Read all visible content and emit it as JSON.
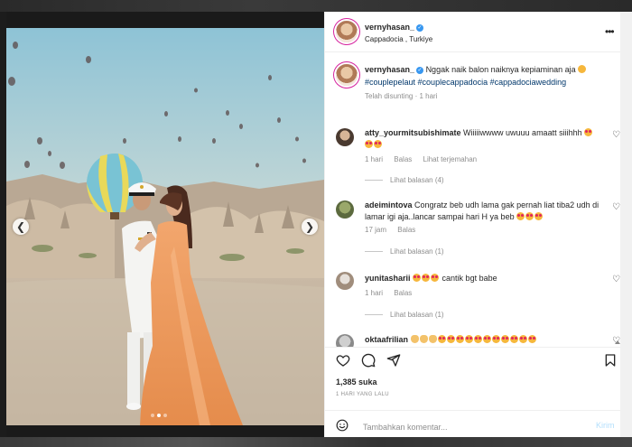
{
  "post": {
    "username": "vernyhasan_",
    "location": "Cappadocia , Turkiye",
    "more_icon": "more-horizontal-icon"
  },
  "caption": {
    "username": "vernyhasan_",
    "text": "Nggak naik balon naiknya kepiaminan aja",
    "hashtags": "#couplepelaut #couplecappadocia #cappadociawedding",
    "edited": "Telah disunting",
    "time": "1 hari"
  },
  "comments": [
    {
      "username": "atty_yourmitsubishimate",
      "text": "Wiiiiiwwww uwuuu amaatt siiihhh",
      "time": "1 hari",
      "reply": "Balas",
      "translate": "Lihat terjemahan",
      "replies": "Lihat balasan (4)"
    },
    {
      "username": "adeimintova",
      "text": "Congratz beb udh lama gak pernah liat tiba2 udh di lamar igi aja..lancar sampai hari H ya beb",
      "time": "17 jam",
      "reply": "Balas",
      "replies": "Lihat balasan (1)"
    },
    {
      "username": "yunitasharii",
      "text": "cantik bgt babe",
      "time": "1 hari",
      "reply": "Balas",
      "replies": "Lihat balasan (1)"
    },
    {
      "username": "oktaafrilian",
      "text": ""
    }
  ],
  "actions": {
    "likes": "1,385 suka",
    "time": "1 HARI YANG LALU"
  },
  "add_comment": {
    "placeholder": "Tambahkan komentar...",
    "post": "Kirim"
  },
  "colors": {
    "verified": "#3897f0",
    "hashtag": "#00376b",
    "muted": "#8e8e8e",
    "post_disabled": "#b2dffc"
  }
}
